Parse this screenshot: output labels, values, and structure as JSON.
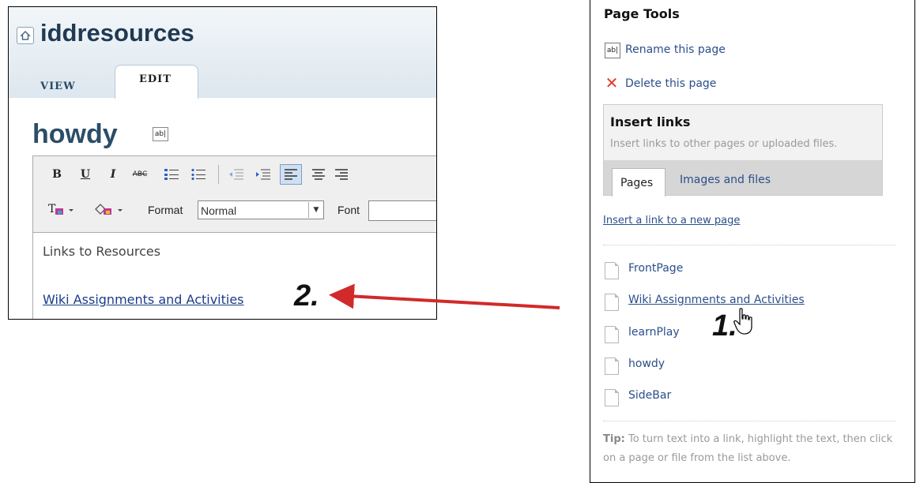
{
  "site": {
    "title": "iddresources",
    "home_icon": "home-icon"
  },
  "tabs": {
    "view": "VIEW",
    "edit": "EDIT"
  },
  "page": {
    "name": "howdy"
  },
  "editor": {
    "format_label": "Format",
    "format_value": "Normal",
    "font_label": "Font",
    "content_heading": "Links to Resources",
    "content_link": "Wiki Assignments and Activities",
    "toolbar_icons": [
      "bold-icon",
      "underline-icon",
      "italic-icon",
      "strikethrough-icon",
      "numbered-list-icon",
      "bulleted-list-icon",
      "outdent-icon",
      "indent-icon",
      "align-left-icon",
      "align-center-icon",
      "align-right-icon",
      "text-color-icon",
      "background-color-icon"
    ]
  },
  "annotations": {
    "marker_1": "1.",
    "marker_2": "2.",
    "arrow_color": "#d12a2a"
  },
  "page_tools": {
    "title": "Page Tools",
    "rename": "Rename this page",
    "delete": "Delete this page",
    "insert_links_title": "Insert links",
    "insert_links_desc": "Insert links to other pages or uploaded files.",
    "tab_pages": "Pages",
    "tab_images": "Images and files",
    "new_page_link": "Insert a link to a new page",
    "pages": [
      "FrontPage",
      "Wiki Assignments and Activities",
      "learnPlay",
      "howdy",
      "SideBar"
    ],
    "tip_bold": "Tip:",
    "tip_text": " To turn text into a link, highlight the text, then click on a page or file from the list above."
  },
  "colors": {
    "link": "#2a4f8a",
    "title": "#1f3a52",
    "delete": "#e23b2a"
  }
}
